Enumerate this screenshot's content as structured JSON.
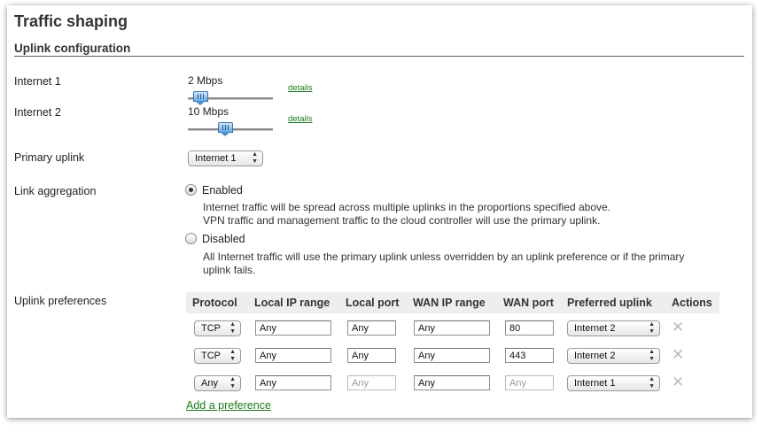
{
  "page_title": "Traffic shaping",
  "section_title": "Uplink configuration",
  "uplinks": [
    {
      "label": "Internet 1",
      "speed": "2 Mbps",
      "level_fraction": 0.14,
      "details": "details"
    },
    {
      "label": "Internet 2",
      "speed": "10 Mbps",
      "level_fraction": 0.44,
      "details": "details"
    }
  ],
  "primary_uplink": {
    "label": "Primary uplink",
    "value": "Internet 1"
  },
  "link_aggregation": {
    "label": "Link aggregation",
    "enabled": {
      "label": "Enabled",
      "selected": true,
      "desc1": "Internet traffic will be spread across multiple uplinks in the proportions specified above.",
      "desc2": "VPN traffic and management traffic to the cloud controller will use the primary uplink."
    },
    "disabled": {
      "label": "Disabled",
      "selected": false,
      "desc1": "All Internet traffic will use the primary uplink unless overridden by an uplink preference or if the primary",
      "desc2": "uplink fails."
    }
  },
  "preferences": {
    "label": "Uplink preferences",
    "columns": [
      "Protocol",
      "Local IP range",
      "Local port",
      "WAN IP range",
      "WAN port",
      "Preferred uplink",
      "Actions"
    ],
    "rows": [
      {
        "protocol": "TCP",
        "local_ip": "Any",
        "local_port": "Any",
        "wan_ip": "Any",
        "wan_port": "80",
        "uplink": "Internet 2",
        "local_port_disabled": false,
        "wan_port_disabled": false
      },
      {
        "protocol": "TCP",
        "local_ip": "Any",
        "local_port": "Any",
        "wan_ip": "Any",
        "wan_port": "443",
        "uplink": "Internet 2",
        "local_port_disabled": false,
        "wan_port_disabled": false
      },
      {
        "protocol": "Any",
        "local_ip": "Any",
        "local_port": "Any",
        "wan_ip": "Any",
        "wan_port": "Any",
        "uplink": "Internet 1",
        "local_port_disabled": true,
        "wan_port_disabled": true
      }
    ],
    "add_label": "Add a preference",
    "remove_icon": "close-icon"
  }
}
